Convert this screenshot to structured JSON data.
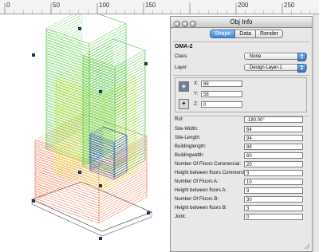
{
  "ruler": {
    "labels": [
      "0",
      "50",
      "100",
      "150",
      "200",
      "250"
    ]
  },
  "palette": {
    "title": "Obj Info",
    "tabs": [
      "Shape",
      "Data",
      "Render"
    ],
    "object_name": "OMA-2",
    "class_label": "Class:",
    "class_value": "None",
    "layer_label": "Layer:",
    "layer_value": "Design Layer-1",
    "x_label": "X:",
    "x_value": "88",
    "y_label": "Y:",
    "y_value": "58",
    "z_label": "Z:",
    "z_value": "0",
    "params": [
      {
        "label": "Rot:",
        "value": "-180.00°"
      },
      {
        "label": "Site-Width:",
        "value": "64"
      },
      {
        "label": "Site-Length:",
        "value": "94"
      },
      {
        "label": "Buildinglength:",
        "value": "88"
      },
      {
        "label": "Buildingwidth:",
        "value": "60"
      },
      {
        "label": "Number Of Floors Commercial:",
        "value": "20"
      },
      {
        "label": "Height between floors Commercial:",
        "value": "3"
      },
      {
        "label": "Number Of Floors A:",
        "value": "10"
      },
      {
        "label": "Height between floors A:",
        "value": "3"
      },
      {
        "label": "Number Of Floors B:",
        "value": "30"
      },
      {
        "label": "Height between floors B:",
        "value": "3"
      },
      {
        "label": "Joint:",
        "value": "0"
      }
    ]
  },
  "colors": {
    "green": "#3fbf2f",
    "yellow": "#f2f23a",
    "orange": "#ef6a3d",
    "blue": "#2a2adf",
    "tab_selected": "#3f86d9"
  }
}
